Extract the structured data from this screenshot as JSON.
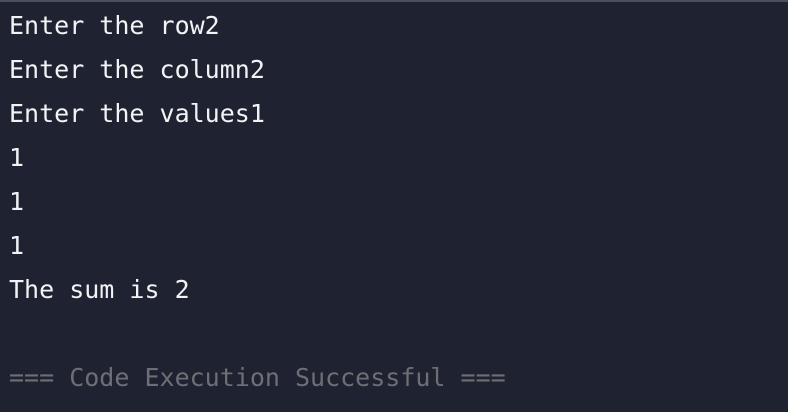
{
  "output": {
    "lines": [
      "Enter the row2",
      "Enter the column2",
      "Enter the values1",
      "1",
      "1",
      "1",
      "The sum is 2"
    ],
    "status": "=== Code Execution Successful ==="
  },
  "colors": {
    "background": "#1f2331",
    "text": "#f2f3f5",
    "muted_text": "#6d6f75",
    "top_border": "#4b4f5c"
  }
}
